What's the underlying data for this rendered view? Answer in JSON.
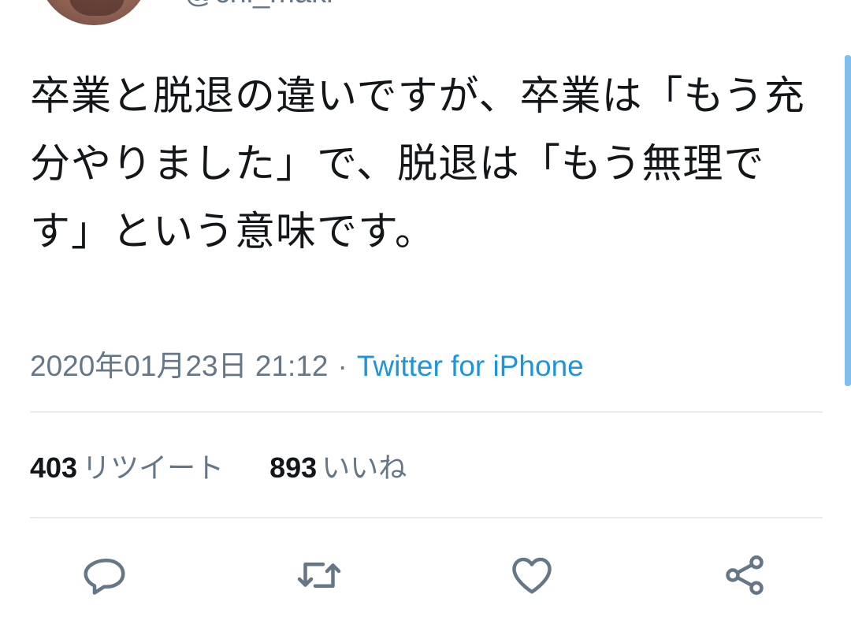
{
  "author": {
    "handle": "@chi_maki"
  },
  "tweet": {
    "text": "卒業と脱退の違いですが、卒業は「もう充分やりました」で、脱退は「もう無理です」という意味です。",
    "timestamp": "2020年01月23日 21:12",
    "separator": "·",
    "source": "Twitter for iPhone"
  },
  "stats": {
    "retweets_count": "403",
    "retweets_label": "リツイート",
    "likes_count": "893",
    "likes_label": "いいね"
  },
  "actions": {
    "reply_icon": "reply-icon",
    "retweet_icon": "retweet-icon",
    "like_icon": "heart-icon",
    "share_icon": "share-icon"
  },
  "colors": {
    "text": "#14171a",
    "secondary": "#657786",
    "link": "#1b95e0",
    "divider": "#e6ecf0",
    "scrollbar": "#7fbfee"
  }
}
